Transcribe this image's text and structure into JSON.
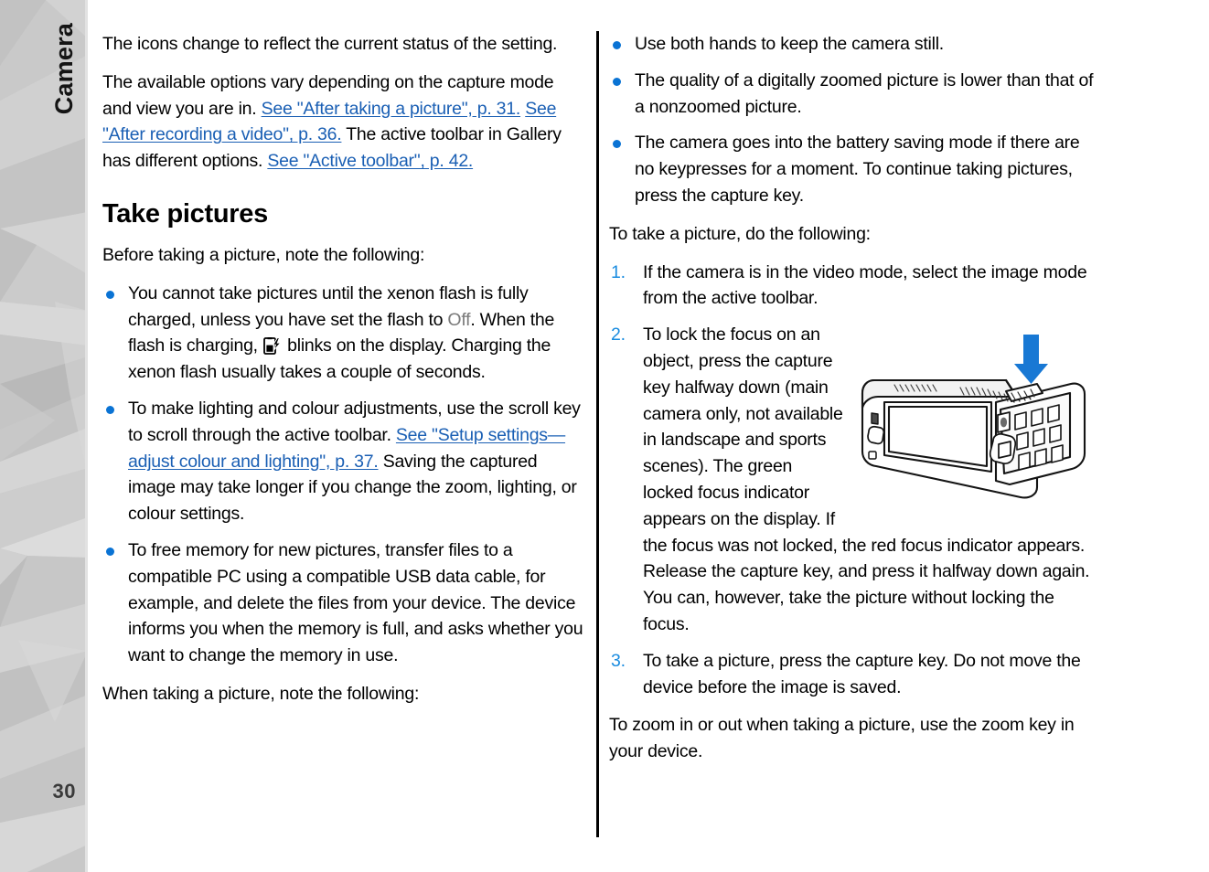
{
  "sidebar": {
    "chapter_label": "Camera",
    "page_number": "30"
  },
  "left_column": {
    "para_icons_status": "The icons change to reflect the current status of the setting.",
    "para_options_vary_1": "The available options vary depending on the capture mode and view you are in. ",
    "link_after_taking_picture": "See \"After taking a picture\", p. 31.",
    "para_options_vary_2": " ",
    "link_after_recording_video": "See \"After recording a video\", p. 36.",
    "para_options_vary_3": " The active toolbar in Gallery has different options. ",
    "link_active_toolbar": "See \"Active toolbar\", p. 42.",
    "heading_take_pictures": "Take pictures",
    "para_before_taking": "Before taking a picture, note the following:",
    "bullet1_part1": "You cannot take pictures until the xenon flash is fully charged, unless you have set the flash to ",
    "bullet1_uiterm_off": "Off",
    "bullet1_part2": ". When the flash is charging, ",
    "bullet1_icon_name": "flash-charging-icon",
    "bullet1_part3": " blinks on the display. Charging the xenon flash usually takes a couple of seconds.",
    "bullet2_part1": "To make lighting and colour adjustments, use the scroll key to scroll through the active toolbar. ",
    "bullet2_link": "See \"Setup settings—adjust colour and lighting\", p. 37.",
    "bullet2_part2": " Saving the captured image may take longer if you change the zoom, lighting, or colour settings.",
    "bullet3": "To free memory for new pictures, transfer files to a compatible PC using a compatible USB data cable, for example, and delete the files from your device. The device informs you when the memory is full, and asks whether you want to change the memory in use.",
    "para_when_taking": "When taking a picture, note the following:"
  },
  "right_column": {
    "bullet1": "Use both hands to keep the camera still.",
    "bullet2": "The quality of a digitally zoomed picture is lower than that of a nonzoomed picture.",
    "bullet3": "The camera goes into the battery saving mode if there are no keypresses for a moment. To continue taking pictures, press the capture key.",
    "para_to_take_picture": "To take a picture, do the following:",
    "step1_num": "1.",
    "step1_text": "If the camera is in the video mode, select the image mode from the active toolbar.",
    "step2_num": "2.",
    "step2_text": "To lock the focus on an object, press the capture key halfway down (main camera only, not available in landscape and sports scenes). The green locked focus indicator appears on the display. If the focus was not locked, the red focus indicator appears. Release the capture key, and press it halfway down again. You can, however, take the picture without locking the focus.",
    "step3_num": "3.",
    "step3_text": "To take a picture, press the capture key. Do not move the device before the image is saved.",
    "para_zoom": "To zoom in or out when taking a picture, use the zoom key in your device.",
    "figure_name": "phone-capture-key-illustration"
  },
  "colors": {
    "link_blue": "#1a5fb4",
    "bullet_blue": "#0a73d4",
    "step_number_blue": "#1a8ce0",
    "ui_term_gray": "#7a7a7a",
    "arrow_blue": "#1878d4",
    "text_black": "#000000"
  }
}
